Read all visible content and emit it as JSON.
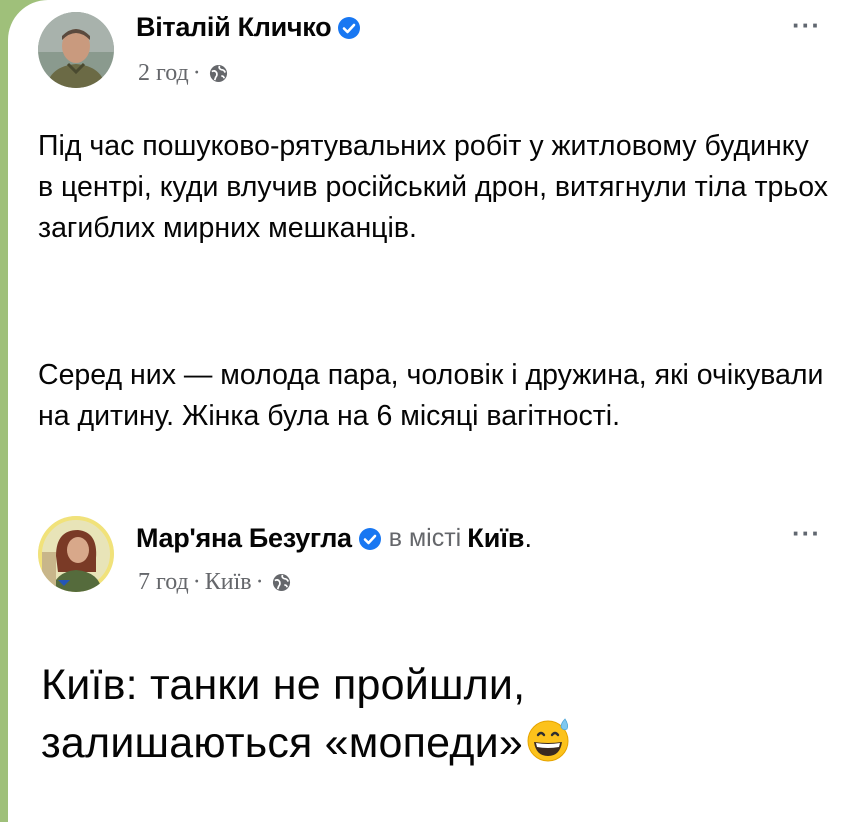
{
  "posts": [
    {
      "author": "Віталій Кличко",
      "verified": true,
      "time": "2 год",
      "separator": "·",
      "privacy_icon": "globe-icon",
      "more_label": "···",
      "paragraphs": [
        "Під час пошуково-рятувальних робіт у житловому будинку в центрі, куди влучив російський дрон, витягнули тіла трьох загиблих мирних мешканців.",
        "Серед них — молода пара, чоловік і дружина, які очікували на дитину. Жінка була на 6 місяці вагітності."
      ]
    },
    {
      "author": "Мар'яна Безугла",
      "verified": true,
      "checkin_prefix": "в місті",
      "checkin_place": "Київ",
      "checkin_suffix": ".",
      "time": "7 год",
      "separator": "·",
      "location": "Київ",
      "privacy_icon": "globe-icon",
      "more_label": "···",
      "text": "Київ: танки не пройшли, залишаються «мопеди»",
      "emoji": "grinning-face-with-sweat-emoji"
    }
  ],
  "colors": {
    "background": "#9fc07a",
    "card": "#ffffff",
    "verified_badge": "#1877f2",
    "meta_text": "#65676b",
    "text": "#050505"
  }
}
